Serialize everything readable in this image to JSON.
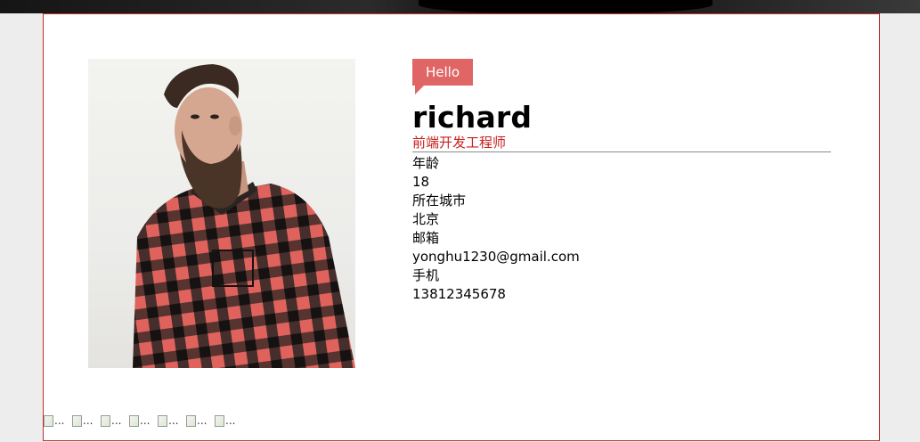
{
  "banner": {
    "icon": "header-background-image"
  },
  "profile": {
    "photo_icon": "profile-photo",
    "greeting": "Hello",
    "name": "richard",
    "job_title": "前端开发工程师",
    "fields": [
      {
        "label": "年龄",
        "value": "18"
      },
      {
        "label": "所在城市",
        "value": "北京"
      },
      {
        "label": "邮箱",
        "value": "yonghu1230@gmail.com"
      },
      {
        "label": "手机",
        "value": "13812345678"
      }
    ]
  },
  "broken_images": [
    {
      "alt": "..."
    },
    {
      "alt": "..."
    },
    {
      "alt": "..."
    },
    {
      "alt": "..."
    },
    {
      "alt": "..."
    },
    {
      "alt": "..."
    },
    {
      "alt": "..."
    }
  ],
  "colors": {
    "accent": "#e06666",
    "job_title": "#c81f1f",
    "card_border": "#c22f2f",
    "page_background": "#ededed"
  }
}
